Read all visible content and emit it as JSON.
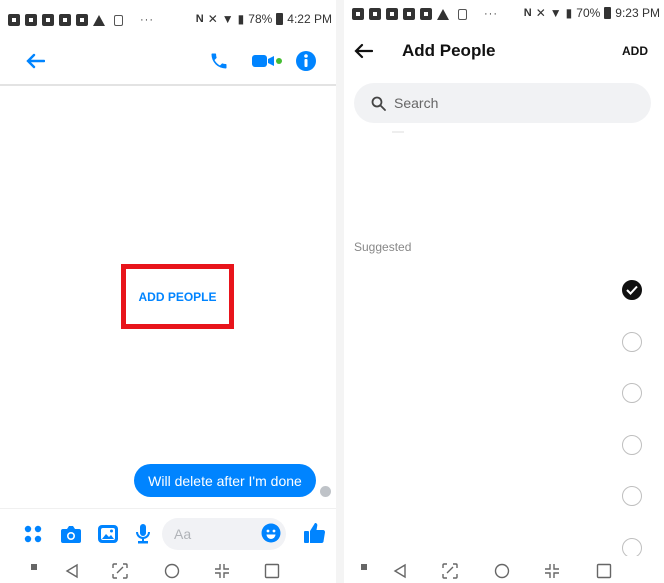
{
  "left": {
    "status": {
      "battery": "78%",
      "time": "4:22 PM"
    },
    "placeholder_link": "ADD PEOPLE",
    "message": "Will delete after I'm done",
    "composer": {
      "placeholder": "Aa"
    }
  },
  "right": {
    "status": {
      "battery": "70%",
      "time": "9:23 PM"
    },
    "header": {
      "title": "Add People",
      "add_label": "ADD"
    },
    "search": {
      "placeholder": "Search"
    },
    "section_label": "Suggested",
    "suggestions": [
      {
        "selected": true
      },
      {
        "selected": false
      },
      {
        "selected": false
      },
      {
        "selected": false
      },
      {
        "selected": false
      },
      {
        "selected": false
      }
    ]
  },
  "colors": {
    "accent": "#0084ff",
    "highlight_box": "#e8141b",
    "check": "#111111"
  },
  "icons": {
    "left_toolbar": [
      "back-arrow-icon",
      "phone-icon",
      "video-camera-icon",
      "info-icon"
    ],
    "composer": [
      "apps-grid-icon",
      "camera-icon",
      "gallery-icon",
      "microphone-icon",
      "emoji-icon",
      "thumbs-up-icon"
    ],
    "navbar": [
      "recents-square-icon",
      "back-triangle-icon",
      "screen-capture-icon",
      "home-circle-icon",
      "split-screen-icon",
      "overview-square-icon"
    ]
  }
}
